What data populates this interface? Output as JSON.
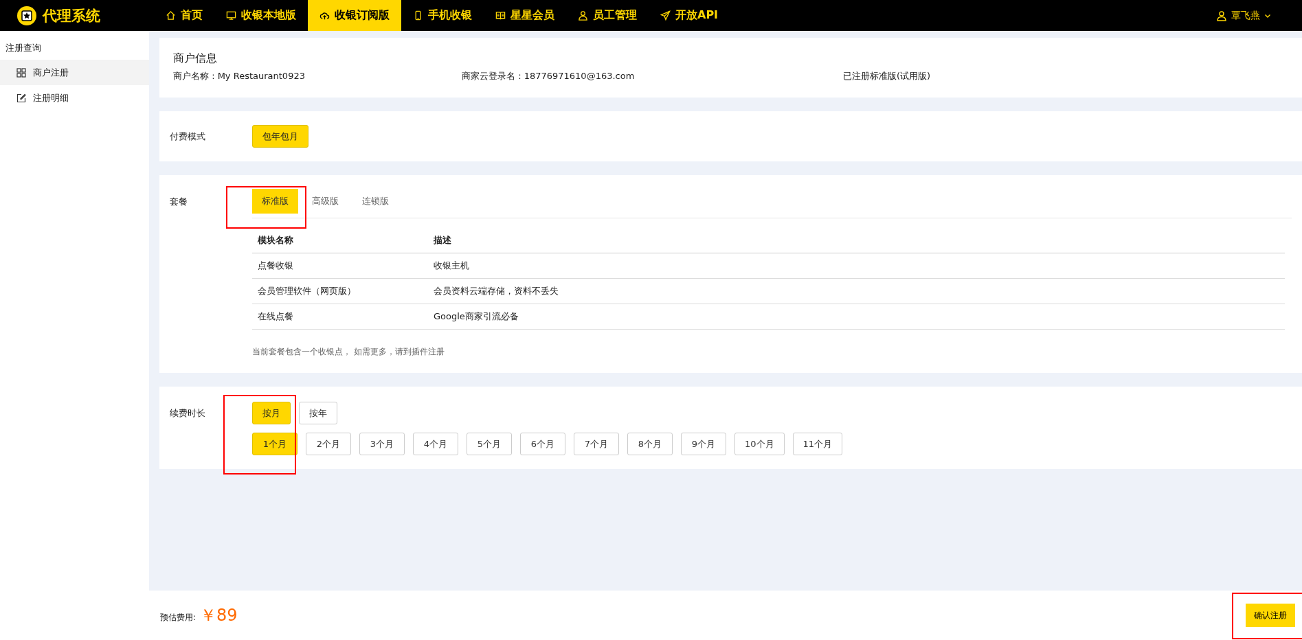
{
  "brand": {
    "title": "代理系统"
  },
  "nav": [
    {
      "label": "首页",
      "kind": "home",
      "selected": false
    },
    {
      "label": "收银本地版",
      "kind": "monitor",
      "selected": false
    },
    {
      "label": "收银订阅版",
      "kind": "cloud",
      "selected": true
    },
    {
      "label": "手机收银",
      "kind": "phone",
      "selected": false
    },
    {
      "label": "星星会员",
      "kind": "book",
      "selected": false
    },
    {
      "label": "员工管理",
      "kind": "user",
      "selected": false
    },
    {
      "label": "开放API",
      "kind": "send",
      "selected": false
    }
  ],
  "user": {
    "name": "覃飞燕"
  },
  "sidebar": {
    "heading": "注册查询",
    "items": [
      {
        "label": "商户注册",
        "kind": "grid",
        "selected": true
      },
      {
        "label": "注册明细",
        "kind": "edit",
        "selected": false
      }
    ]
  },
  "merchant": {
    "title": "商户信息",
    "fields": [
      "商户名称 : My Restaurant0923",
      "商家云登录名 : 18776971610@163.com",
      "已注册标准版(试用版)"
    ]
  },
  "payment": {
    "label": "付费模式",
    "options": [
      {
        "label": "包年包月",
        "selected": true
      }
    ]
  },
  "package": {
    "label": "套餐",
    "highlighted": true,
    "tabs": [
      {
        "label": "标准版",
        "selected": true
      },
      {
        "label": "高级版",
        "selected": false
      },
      {
        "label": "连锁版",
        "selected": false
      }
    ],
    "columns": [
      "模块名称",
      "描述"
    ],
    "rows": [
      [
        "点餐收银",
        "收银主机"
      ],
      [
        "会员管理软件（网页版）",
        "会员资料云端存储，资料不丢失"
      ],
      [
        "在线点餐",
        "Google商家引流必备"
      ]
    ],
    "note": "当前套餐包含一个收银点， 如需更多，请到插件注册"
  },
  "renewal": {
    "label": "续费时长",
    "highlighted": true,
    "units": [
      {
        "label": "按月",
        "selected": true
      },
      {
        "label": "按年",
        "selected": false
      }
    ],
    "durations": [
      {
        "label": "1个月",
        "selected": true
      },
      {
        "label": "2个月",
        "selected": false
      },
      {
        "label": "3个月",
        "selected": false
      },
      {
        "label": "4个月",
        "selected": false
      },
      {
        "label": "5个月",
        "selected": false
      },
      {
        "label": "6个月",
        "selected": false
      },
      {
        "label": "7个月",
        "selected": false
      },
      {
        "label": "8个月",
        "selected": false
      },
      {
        "label": "9个月",
        "selected": false
      },
      {
        "label": "10个月",
        "selected": false
      },
      {
        "label": "11个月",
        "selected": false
      }
    ]
  },
  "footer": {
    "label": "预估费用:",
    "price": "￥89",
    "confirm": {
      "label": "确认注册",
      "highlighted": true
    }
  }
}
